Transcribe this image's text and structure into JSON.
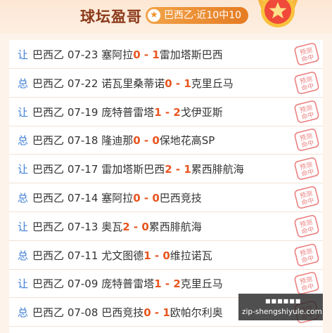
{
  "header": {
    "title": "球坛盈哥",
    "badge_label": "巴西乙·近10中10",
    "badge_icon": "star-icon",
    "medal_icon": "star-medal-icon"
  },
  "stamp": {
    "line1": "预测",
    "line2": "命中",
    "color": "#e86b6b"
  },
  "colors": {
    "type": "#3f7fd6",
    "score": "#e8551f",
    "text": "#333333"
  },
  "rows": [
    {
      "type": "让",
      "league": "巴西乙",
      "date": "07-23",
      "home": "塞阿拉",
      "home_score": "0",
      "sep": " - ",
      "away_score": "1",
      "away": "雷加塔斯巴西"
    },
    {
      "type": "总",
      "league": "巴西乙",
      "date": "07-22",
      "home": "诺瓦里桑蒂诺",
      "home_score": "0",
      "sep": " - ",
      "away_score": "1",
      "away": "克里丘马"
    },
    {
      "type": "让",
      "league": "巴西乙",
      "date": "07-19",
      "home": "庞特普雷塔",
      "home_score": "1",
      "sep": " - ",
      "away_score": "2",
      "away": "戈伊亚斯"
    },
    {
      "type": "总",
      "league": "巴西乙",
      "date": "07-18",
      "home": "隆迪那",
      "home_score": "0",
      "sep": " - ",
      "away_score": "0",
      "away": "保地花高SP"
    },
    {
      "type": "让",
      "league": "巴西乙",
      "date": "07-17",
      "home": "雷加塔斯巴西",
      "home_score": "2",
      "sep": " - ",
      "away_score": "1",
      "away": "累西腓航海"
    },
    {
      "type": "总",
      "league": "巴西乙",
      "date": "07-14",
      "home": "塞阿拉",
      "home_score": "0",
      "sep": " - ",
      "away_score": "0",
      "away": "巴西竞技"
    },
    {
      "type": "让",
      "league": "巴西乙",
      "date": "07-13",
      "home": "奥瓦",
      "home_score": "2",
      "sep": " - ",
      "away_score": "0",
      "away": "累西腓航海"
    },
    {
      "type": "总",
      "league": "巴西乙",
      "date": "07-11",
      "home": "尤文图德",
      "home_score": "1",
      "sep": " - ",
      "away_score": "0",
      "away": "维拉诺瓦"
    },
    {
      "type": "让",
      "league": "巴西乙",
      "date": "07-09",
      "home": "庞特普雷塔",
      "home_score": "1",
      "sep": " - ",
      "away_score": "2",
      "away": "克里丘马"
    },
    {
      "type": "总",
      "league": "巴西乙",
      "date": "07-08",
      "home": "巴西竞技",
      "home_score": "0",
      "sep": " - ",
      "away_score": "1",
      "away": "欧帕尔利奥"
    }
  ],
  "watermark": {
    "top": "■■■■■■",
    "bottom": "zip-shengshiyule.com"
  }
}
